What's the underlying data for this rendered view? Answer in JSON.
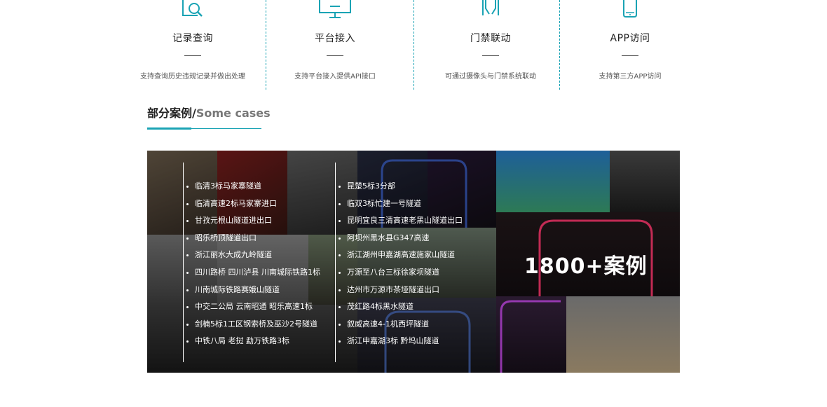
{
  "features": [
    {
      "title": "记录查询",
      "desc": "支持查询历史违规记录并做出处理",
      "icon": "document-search-icon"
    },
    {
      "title": "平台接入",
      "desc": "支持平台接入提供API接口",
      "icon": "monitor-icon"
    },
    {
      "title": "门禁联动",
      "desc": "可通过摄像头与门禁系统联动",
      "icon": "gate-icon"
    },
    {
      "title": "APP访问",
      "desc": "支持第三方APP访问",
      "icon": "smartphone-icon"
    }
  ],
  "cases": {
    "heading_cn": "部分案例/",
    "heading_en": "Some cases",
    "count_label": "1800+案例",
    "left_list": [
      "临清3标马家寨隧道",
      "临清高速2标马家寨进口",
      "甘孜元根山隧道进出口",
      "昭乐桥顶隧道出口",
      "浙江丽水大成九岭隧道",
      "四川路桥 四川泸县 川南城际铁路1标",
      "川南城际铁路赛娥山隧道",
      "中交二公局 云南昭通 昭乐高速1标",
      "剑楠5标1工区钢索桥及巫沙2号隧道",
      "中铁八局 老挝 勐万铁路3标"
    ],
    "right_list": [
      "昆楚5标3分部",
      "临双3标忙建一号隧道",
      "昆明宜良三清高速老黑山隧道出口",
      "阿坝州黑水县G347高速",
      "浙江湖州申嘉湖高速施家山隧道",
      "万源至八台三标徐家坝隧道",
      "达州市万源市茶垭隧道出口",
      "茂红路4标黑水隧道",
      "叙威高速4-1机西坪隧道",
      "浙江申嘉湖3标 黔坞山隧道"
    ]
  },
  "colors": {
    "accent": "#1aa3b4",
    "text": "#222222",
    "muted": "#777777"
  }
}
